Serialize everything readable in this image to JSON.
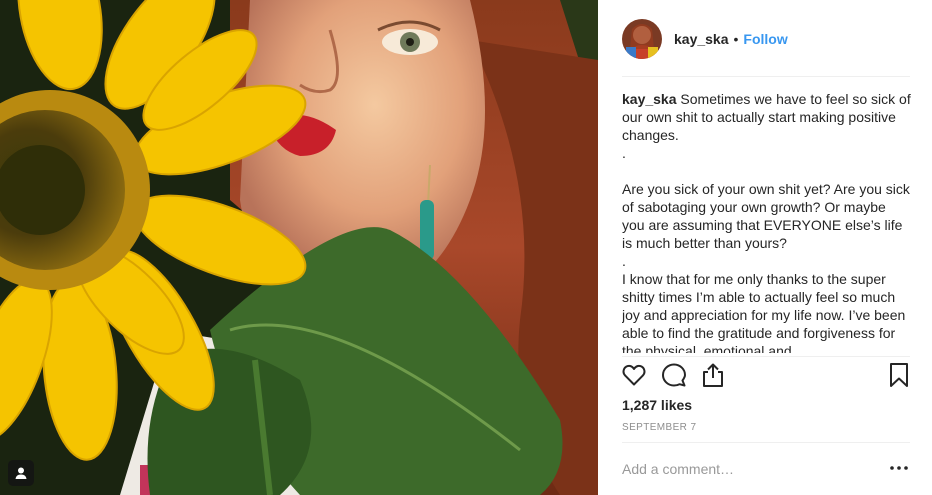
{
  "post": {
    "photo_subject": "portrait-with-sunflower",
    "author": {
      "username": "kay_ska",
      "separator": "•",
      "follow_label": "Follow"
    },
    "caption": {
      "username": "kay_ska",
      "text": " Sometimes we have to feel so sick of our own shit to actually start making positive changes.\n.\n\nAre you sick of your own shit yet? Are you sick of sabotaging your own growth? Or maybe you are assuming that EVERYONE else’s life is much better than yours?\n.\nI know that for me only thanks to the super shitty times I’m able to actually feel so much joy and appreciation for my life now. I’ve been able to find the gratitude and forgiveness for the physical, emotional and"
    },
    "likes": "1,287 likes",
    "date": "SEPTEMBER 7",
    "comment": {
      "placeholder": "Add a comment…",
      "value": ""
    },
    "icons": {
      "like": "heart-icon",
      "comment": "comment-bubble-icon",
      "share": "share-icon",
      "save": "bookmark-icon",
      "more": "more-options-icon",
      "tagged_user": "user-tag-icon"
    },
    "colors": {
      "accent": "#3897f0",
      "text": "#262626",
      "muted": "#8e8e8e",
      "divider": "#efefef"
    }
  }
}
